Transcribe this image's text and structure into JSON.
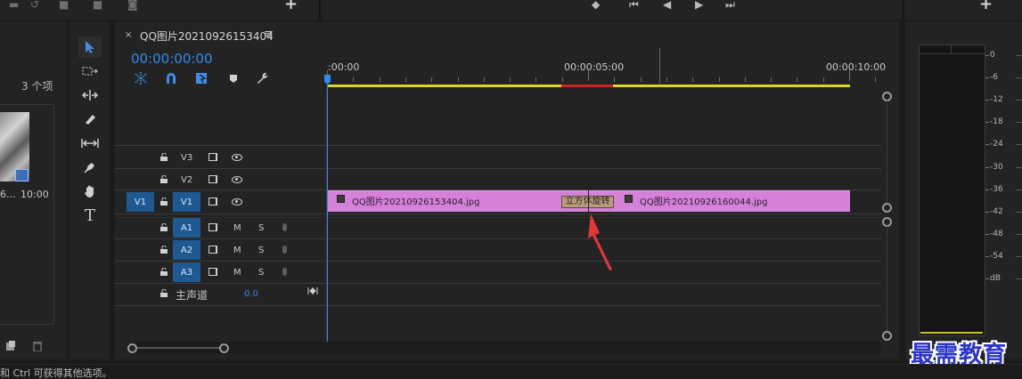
{
  "top": {
    "plus_left": "+",
    "plus_right": "+"
  },
  "project": {
    "item_count": "3 个项",
    "thumb_name": "6...",
    "thumb_duration": "10:00"
  },
  "sequence": {
    "close": "×",
    "title": "QQ图片20210926153404",
    "menu": "≡",
    "timecode": "00:00:00:00"
  },
  "ruler": {
    "labels": [
      ":00:00",
      "00:00:05:00",
      "00:00:10:00"
    ]
  },
  "tracks": {
    "v3": "V3",
    "v2": "V2",
    "v1": "V1",
    "v1_source": "V1",
    "a1": "A1",
    "a2": "A2",
    "a3": "A3",
    "mute": "M",
    "solo": "S",
    "master_label": "主声道",
    "master_value": "0.0"
  },
  "clips": {
    "clip1": "QQ图片20210926153404.jpg",
    "transition": "立方体旋转",
    "clip2": "QQ图片20210926160044.jpg"
  },
  "meter": {
    "db_labels": [
      "0",
      "-6",
      "-12",
      "-18",
      "-24",
      "-30",
      "-36",
      "-42",
      "-48",
      "-54",
      "dB"
    ]
  },
  "watermark": "最需教育",
  "status": "和 Ctrl 可获得其他选项。",
  "colors": {
    "accent": "#2d8ceb",
    "clip": "#d581d9",
    "work_area": "#d8d816",
    "render_red": "#d02222",
    "track_select": "#1e5a91"
  }
}
